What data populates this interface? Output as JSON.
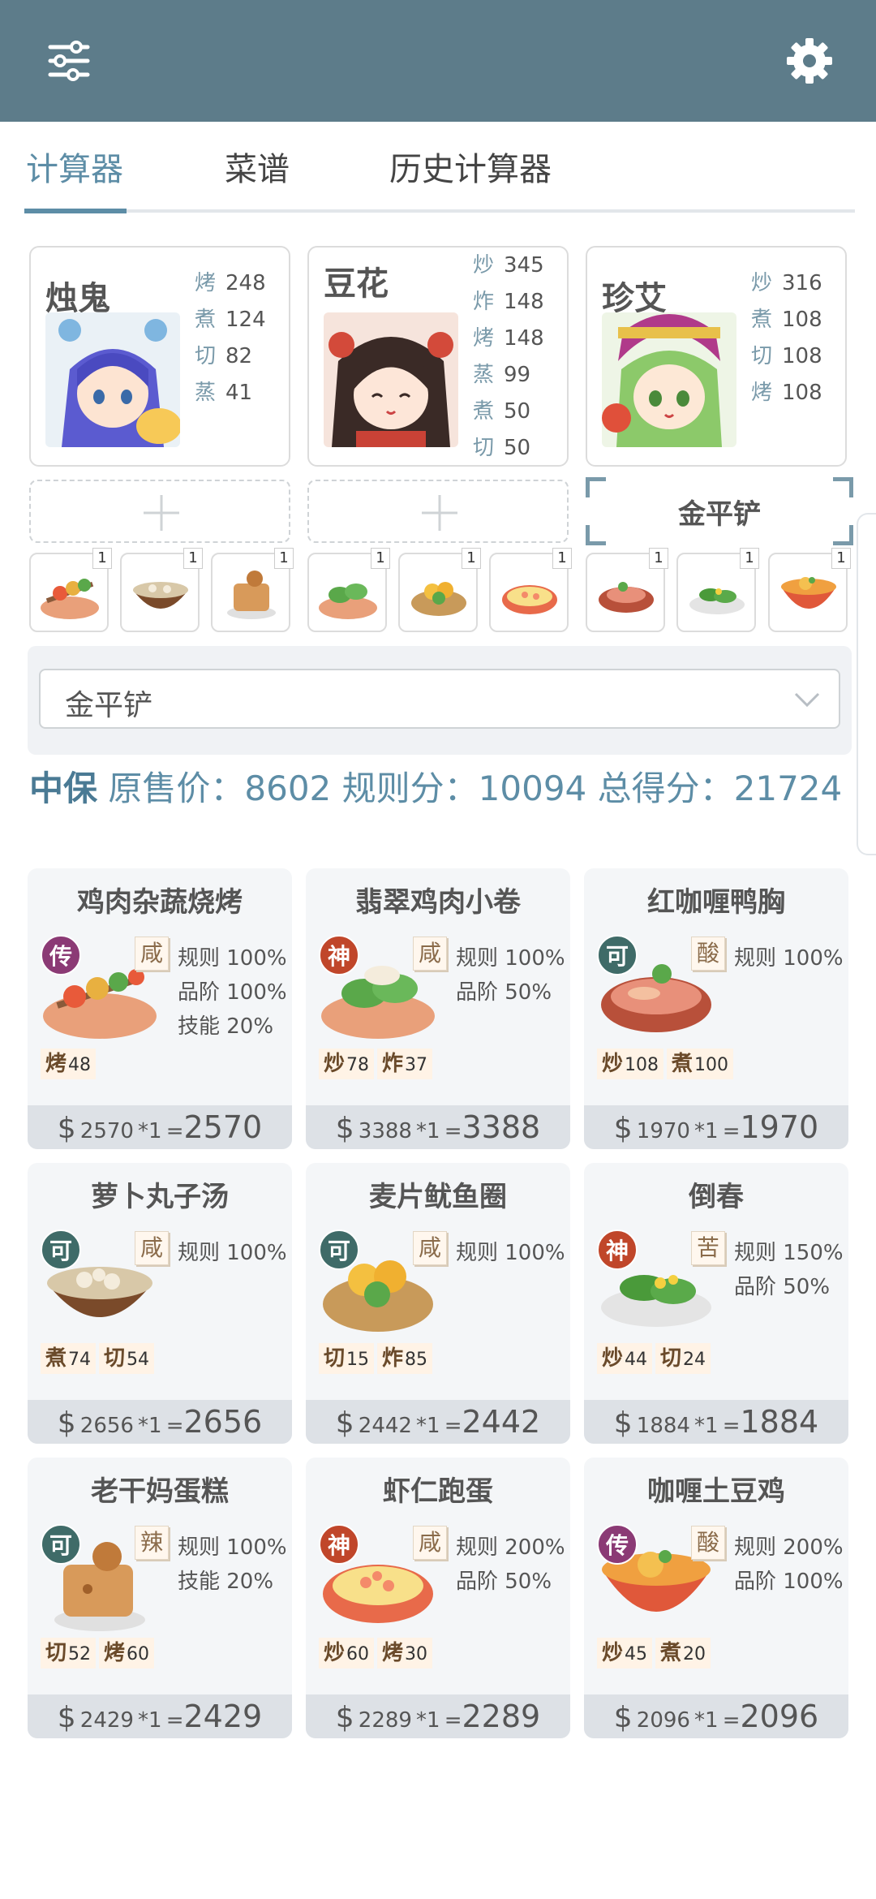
{
  "tabs": [
    "计算器",
    "菜谱",
    "历史计算器"
  ],
  "chefs": [
    {
      "name": "烛鬼",
      "skills": [
        {
          "k": "烤",
          "v": "248"
        },
        {
          "k": "煮",
          "v": "124"
        },
        {
          "k": "切",
          "v": "82"
        },
        {
          "k": "蒸",
          "v": "41"
        }
      ]
    },
    {
      "name": "豆花",
      "skills": [
        {
          "k": "炒",
          "v": "345"
        },
        {
          "k": "炸",
          "v": "148"
        },
        {
          "k": "烤",
          "v": "148"
        },
        {
          "k": "蒸",
          "v": "99"
        },
        {
          "k": "煮",
          "v": "50"
        },
        {
          "k": "切",
          "v": "50"
        }
      ]
    },
    {
      "name": "珍艾",
      "skills": [
        {
          "k": "炒",
          "v": "316"
        },
        {
          "k": "煮",
          "v": "108"
        },
        {
          "k": "切",
          "v": "108"
        },
        {
          "k": "烤",
          "v": "108"
        }
      ]
    }
  ],
  "equipment": {
    "selected": "金平铲"
  },
  "dish_counts": [
    "1",
    "1",
    "1",
    "1",
    "1",
    "1",
    "1",
    "1",
    "1"
  ],
  "select": {
    "value": "金平铲"
  },
  "summary": {
    "level": "中保",
    "base_label": "原售价：",
    "base": "8602",
    "rule_label": "规则分：",
    "rule": "10094",
    "total_label": "总得分：",
    "total": "21724"
  },
  "recipes": [
    {
      "name": "鸡肉杂蔬烧烤",
      "rarity": "传",
      "flavor": "咸",
      "adds": [
        "规则 100%",
        "品阶 100%",
        "技能 20%"
      ],
      "reqs": [
        {
          "k": "烤",
          "v": "48"
        }
      ],
      "price": "2570",
      "mult": "*1",
      "total": "2570"
    },
    {
      "name": "翡翠鸡肉小卷",
      "rarity": "神",
      "flavor": "咸",
      "adds": [
        "规则 100%",
        "品阶 50%"
      ],
      "reqs": [
        {
          "k": "炒",
          "v": "78"
        },
        {
          "k": "炸",
          "v": "37"
        }
      ],
      "price": "3388",
      "mult": "*1",
      "total": "3388"
    },
    {
      "name": "红咖喱鸭胸",
      "rarity": "可",
      "flavor": "酸",
      "adds": [
        "规则 100%"
      ],
      "reqs": [
        {
          "k": "炒",
          "v": "108"
        },
        {
          "k": "煮",
          "v": "100"
        }
      ],
      "price": "1970",
      "mult": "*1",
      "total": "1970"
    },
    {
      "name": "萝卜丸子汤",
      "rarity": "可",
      "flavor": "咸",
      "adds": [
        "规则 100%"
      ],
      "reqs": [
        {
          "k": "煮",
          "v": "74"
        },
        {
          "k": "切",
          "v": "54"
        }
      ],
      "price": "2656",
      "mult": "*1",
      "total": "2656"
    },
    {
      "name": "麦片鱿鱼圈",
      "rarity": "可",
      "flavor": "咸",
      "adds": [
        "规则 100%"
      ],
      "reqs": [
        {
          "k": "切",
          "v": "15"
        },
        {
          "k": "炸",
          "v": "85"
        }
      ],
      "price": "2442",
      "mult": "*1",
      "total": "2442"
    },
    {
      "name": "倒春",
      "rarity": "神",
      "flavor": "苦",
      "adds": [
        "规则 150%",
        "品阶 50%"
      ],
      "reqs": [
        {
          "k": "炒",
          "v": "44"
        },
        {
          "k": "切",
          "v": "24"
        }
      ],
      "price": "1884",
      "mult": "*1",
      "total": "1884"
    },
    {
      "name": "老干妈蛋糕",
      "rarity": "可",
      "flavor": "辣",
      "adds": [
        "规则 100%",
        "技能 20%"
      ],
      "reqs": [
        {
          "k": "切",
          "v": "52"
        },
        {
          "k": "烤",
          "v": "60"
        }
      ],
      "price": "2429",
      "mult": "*1",
      "total": "2429"
    },
    {
      "name": "虾仁跑蛋",
      "rarity": "神",
      "flavor": "咸",
      "adds": [
        "规则 200%",
        "品阶 50%"
      ],
      "reqs": [
        {
          "k": "炒",
          "v": "60"
        },
        {
          "k": "烤",
          "v": "30"
        }
      ],
      "price": "2289",
      "mult": "*1",
      "total": "2289"
    },
    {
      "name": "咖喱土豆鸡",
      "rarity": "传",
      "flavor": "酸",
      "adds": [
        "规则 200%",
        "品阶 100%"
      ],
      "reqs": [
        {
          "k": "炒",
          "v": "45"
        },
        {
          "k": "煮",
          "v": "20"
        }
      ],
      "price": "2096",
      "mult": "*1",
      "total": "2096"
    }
  ],
  "colors": {
    "topbar": "#5d7c8a",
    "accent": "#5d8da6",
    "rarity_legend": "#8b3a75",
    "rarity_god": "#c0462a",
    "rarity_ok": "#3f6b68"
  },
  "icons": {
    "menu": "sliders-icon",
    "settings": "gear-icon",
    "add": "plus-icon",
    "dropdown": "chevron-down-icon"
  }
}
